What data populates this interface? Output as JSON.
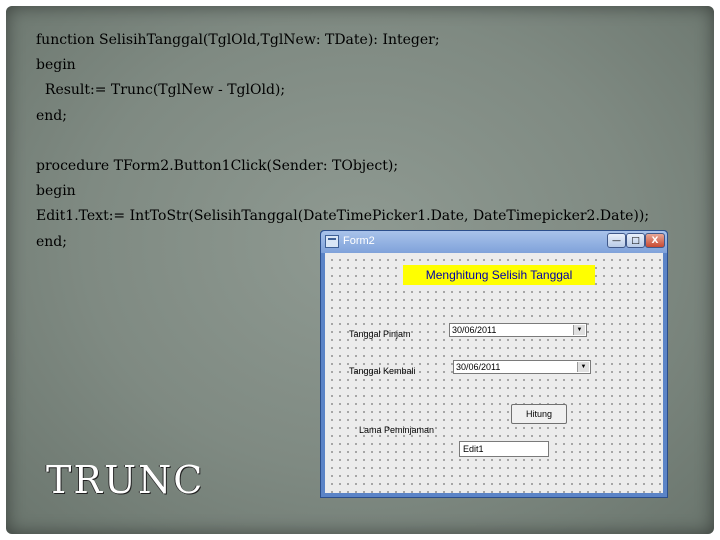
{
  "code": {
    "line1": "function SelisihTanggal(TglOld,TglNew: TDate): Integer;",
    "line2": "begin",
    "line3": "  Result:= Trunc(TglNew - TglOld);",
    "line4": "end;",
    "line5": "procedure TForm2.Button1Click(Sender: TObject);",
    "line6": "begin",
    "line7": "Edit1.Text:= IntToStr(SelisihTanggal(DateTimePicker1.Date, DateTimepicker2.Date));",
    "line8": "end;"
  },
  "slide_title": "TRUNC",
  "window": {
    "title": "Form2",
    "min_glyph": "—",
    "max_glyph": "□",
    "close_glyph": "X"
  },
  "form": {
    "header": "Menghitung Selisih Tanggal",
    "label_pinjam": "Tanggal Pinjam",
    "date_pinjam": "30/06/2011",
    "label_kembali": "Tanggal Kembali",
    "date_kembali": "30/06/2011",
    "button_label": "Hitung",
    "label_hasil": "Lama Peminjaman",
    "edit_value": "Edit1"
  },
  "icons": {
    "dropdown": "▼"
  }
}
